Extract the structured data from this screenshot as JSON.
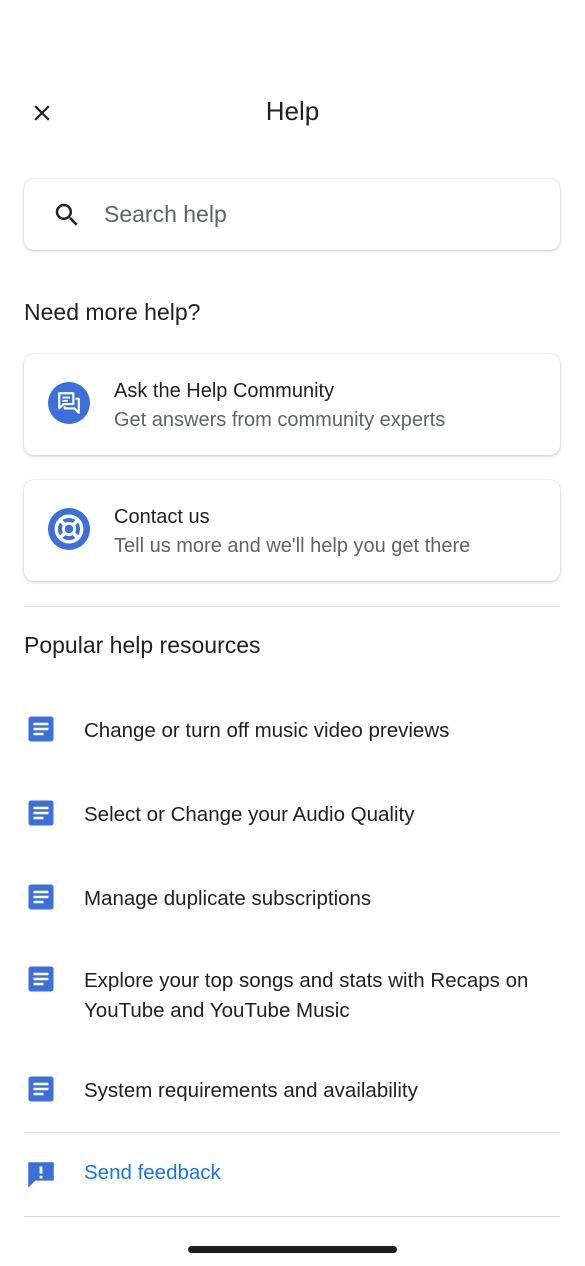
{
  "header": {
    "title": "Help",
    "close_icon": "close-icon"
  },
  "search": {
    "placeholder": "Search help",
    "icon": "search-icon"
  },
  "more_help": {
    "title": "Need more help?",
    "cards": [
      {
        "title": "Ask the Help Community",
        "subtitle": "Get answers from community experts",
        "icon": "community-forum-icon"
      },
      {
        "title": "Contact us",
        "subtitle": "Tell us more and we'll help you get there",
        "icon": "support-lifebuoy-icon"
      }
    ]
  },
  "popular": {
    "title": "Popular help resources",
    "items": [
      {
        "label": "Change or turn off music video previews",
        "icon": "article-icon"
      },
      {
        "label": "Select or Change your Audio Quality",
        "icon": "article-icon"
      },
      {
        "label": "Manage duplicate subscriptions",
        "icon": "article-icon"
      },
      {
        "label": "Explore your top songs and stats with Recaps on YouTube and YouTube Music",
        "icon": "article-icon"
      },
      {
        "label": "System requirements and availability",
        "icon": "article-icon"
      }
    ]
  },
  "feedback": {
    "label": "Send feedback",
    "icon": "feedback-icon"
  },
  "colors": {
    "accent": "#1a73e8",
    "icon_blue": "#3c6fd8",
    "text_primary": "#202124",
    "text_secondary": "#5f6368",
    "divider": "#dadce0"
  }
}
